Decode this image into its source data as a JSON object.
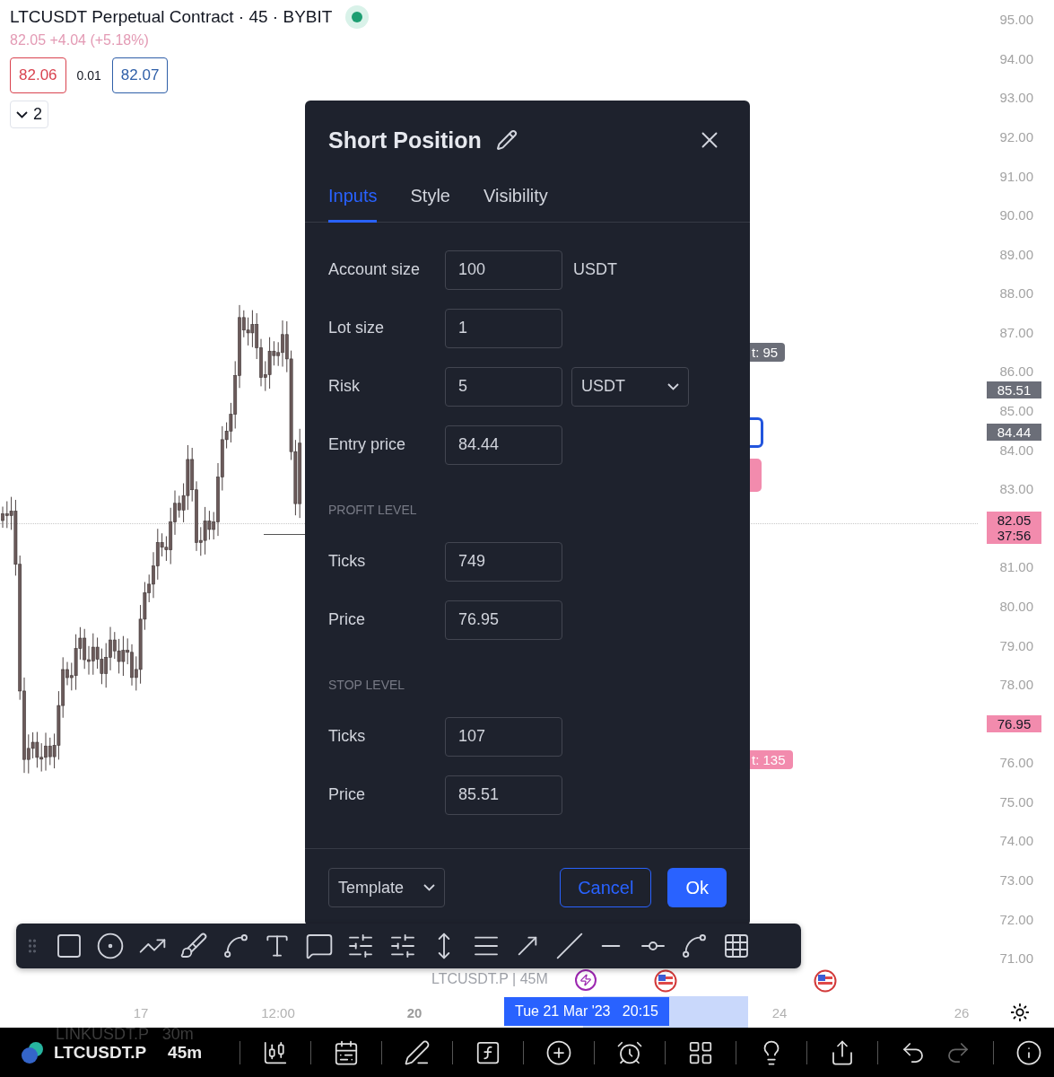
{
  "symbol_header": {
    "title": "LTCUSDT Perpetual Contract · 45 · BYBIT",
    "market_open": true,
    "quote": "82.05 +4.04 (+5.18%)",
    "bid": "82.06",
    "spread": "0.01",
    "ask": "82.07",
    "indicators_count": "2"
  },
  "price_axis": {
    "items": [
      {
        "kind": "tick",
        "lines": [
          "95.00"
        ]
      },
      {
        "kind": "tick",
        "lines": [
          "94.00"
        ]
      },
      {
        "kind": "tick",
        "lines": [
          "93.00"
        ]
      },
      {
        "kind": "tick",
        "lines": [
          "92.00"
        ]
      },
      {
        "kind": "tick",
        "lines": [
          "91.00"
        ]
      },
      {
        "kind": "tick",
        "lines": [
          "90.00"
        ]
      },
      {
        "kind": "tick",
        "lines": [
          "89.00"
        ]
      },
      {
        "kind": "tick",
        "lines": [
          "88.00"
        ]
      },
      {
        "kind": "tick",
        "lines": [
          "87.00"
        ]
      },
      {
        "kind": "tick",
        "lines": [
          "86.00"
        ]
      },
      {
        "kind": "stop",
        "lines": [
          "85.51"
        ]
      },
      {
        "kind": "tick",
        "lines": [
          "85.00"
        ]
      },
      {
        "kind": "entry",
        "lines": [
          "84.44"
        ]
      },
      {
        "kind": "tick",
        "lines": [
          "84.00"
        ]
      },
      {
        "kind": "tick",
        "lines": [
          "83.00"
        ]
      },
      {
        "kind": "last",
        "lines": [
          "82.05",
          "37:56"
        ]
      },
      {
        "kind": "tick",
        "lines": [
          "81.00"
        ]
      },
      {
        "kind": "tick",
        "lines": [
          "80.00"
        ]
      },
      {
        "kind": "tick",
        "lines": [
          "79.00"
        ]
      },
      {
        "kind": "tick",
        "lines": [
          "78.00"
        ]
      },
      {
        "kind": "target",
        "lines": [
          "76.95"
        ]
      },
      {
        "kind": "tick",
        "lines": [
          "76.00"
        ]
      },
      {
        "kind": "tick",
        "lines": [
          "75.00"
        ]
      },
      {
        "kind": "tick",
        "lines": [
          "74.00"
        ]
      },
      {
        "kind": "tick",
        "lines": [
          "73.00"
        ]
      },
      {
        "kind": "tick",
        "lines": [
          "72.00"
        ]
      },
      {
        "kind": "tick",
        "lines": [
          "71.00"
        ]
      }
    ]
  },
  "chart_labels": [
    {
      "kind": "stop",
      "text": "t: 95"
    },
    {
      "kind": "target",
      "text": "t: 135"
    }
  ],
  "chart_watermark": "LTCUSDT.P | 45M",
  "dialog": {
    "title": "Short Position",
    "tabs": [
      {
        "label": "Inputs",
        "selected": true
      },
      {
        "label": "Style",
        "selected": false
      },
      {
        "label": "Visibility",
        "selected": false
      }
    ],
    "rows": [
      {
        "kind": "field",
        "label": "Account size",
        "value": "100",
        "unit": "USDT"
      },
      {
        "kind": "field",
        "label": "Lot size",
        "value": "1"
      },
      {
        "kind": "select",
        "label": "Risk",
        "value": "5",
        "option": "USDT"
      },
      {
        "kind": "field",
        "label": "Entry price",
        "value": "84.44"
      },
      {
        "kind": "section",
        "label": "PROFIT LEVEL"
      },
      {
        "kind": "field",
        "label": "Ticks",
        "value": "749"
      },
      {
        "kind": "field",
        "label": "Price",
        "value": "76.95"
      },
      {
        "kind": "section",
        "label": "STOP LEVEL"
      },
      {
        "kind": "field",
        "label": "Ticks",
        "value": "107"
      },
      {
        "kind": "field",
        "label": "Price",
        "value": "85.51"
      }
    ],
    "footer": {
      "template": "Template",
      "cancel": "Cancel",
      "ok": "Ok"
    }
  },
  "time_axis": {
    "labels": [
      {
        "text": "17",
        "major": false
      },
      {
        "text": "12:00",
        "major": false
      },
      {
        "text": "20",
        "major": true
      },
      {
        "text": "24",
        "major": false
      },
      {
        "text": "26",
        "major": false
      }
    ],
    "crosshair": "Tue 21 Mar '23   20:15"
  },
  "bottom_bar": {
    "recent_symbol": "LINKUSDT.P   30m",
    "symbol": "LTCUSDT.P",
    "interval": "45m",
    "redo_disabled": true
  }
}
